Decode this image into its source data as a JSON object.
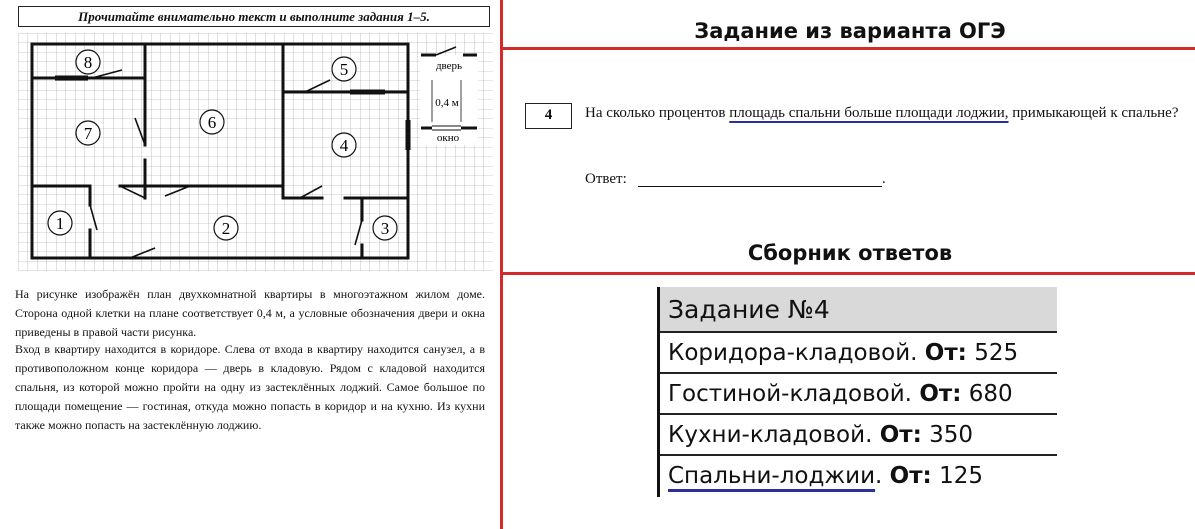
{
  "task_header": "Прочитайте внимательно текст и выполните задания 1–5.",
  "plan": {
    "rooms": [
      "8",
      "5",
      "7",
      "6",
      "4",
      "1",
      "2",
      "3"
    ],
    "legend": {
      "door": "дверь",
      "scale": "0,4 м",
      "window": "окно"
    }
  },
  "intro": {
    "p1": "На рисунке изображён план двухкомнатной квартиры в многоэтажном жилом доме. Сторона одной клетки на плане соответствует 0,4 м, а условные обозначения двери и окна приведены в правой части рисунка.",
    "p2": "Вход в квартиру находится в коридоре. Слева от входа в квартиру находится санузел, а в противоположном конце коридора — дверь в кладовую. Рядом с кладовой находится спальня, из которой можно пройти на одну из застеклённых лоджий. Самое большое по площади помещение — гостиная, откуда можно попасть в коридор и на кухню. Из кухни также можно попасть на застеклённую лоджию."
  },
  "exam_title": "Задание из варианта  ОГЭ",
  "task": {
    "number": "4",
    "question_before": "На сколько процентов ",
    "question_highlight": "площадь спальни больше площади лоджии,",
    "question_after": " примыкающей к спальне?",
    "answer_label": "Ответ:",
    "answer_end": "."
  },
  "answers_title": "Сборник ответов",
  "answers_table": {
    "header": "Задание №4",
    "rows": [
      {
        "name": "Коридора-кладовой.",
        "label": "От:",
        "value": "525"
      },
      {
        "name": "Гостиной-кладовой.",
        "label": "От:",
        "value": "680"
      },
      {
        "name": "Кухни-кладовой.",
        "label": "От:",
        "value": "350"
      },
      {
        "name": "Спальни-лоджии",
        "suffix": ".",
        "label": "От:",
        "value": "125"
      }
    ]
  },
  "colors": {
    "separator": "#d22b2b",
    "underline": "#2b2f9c",
    "table_header_bg": "#d9d9d9"
  }
}
